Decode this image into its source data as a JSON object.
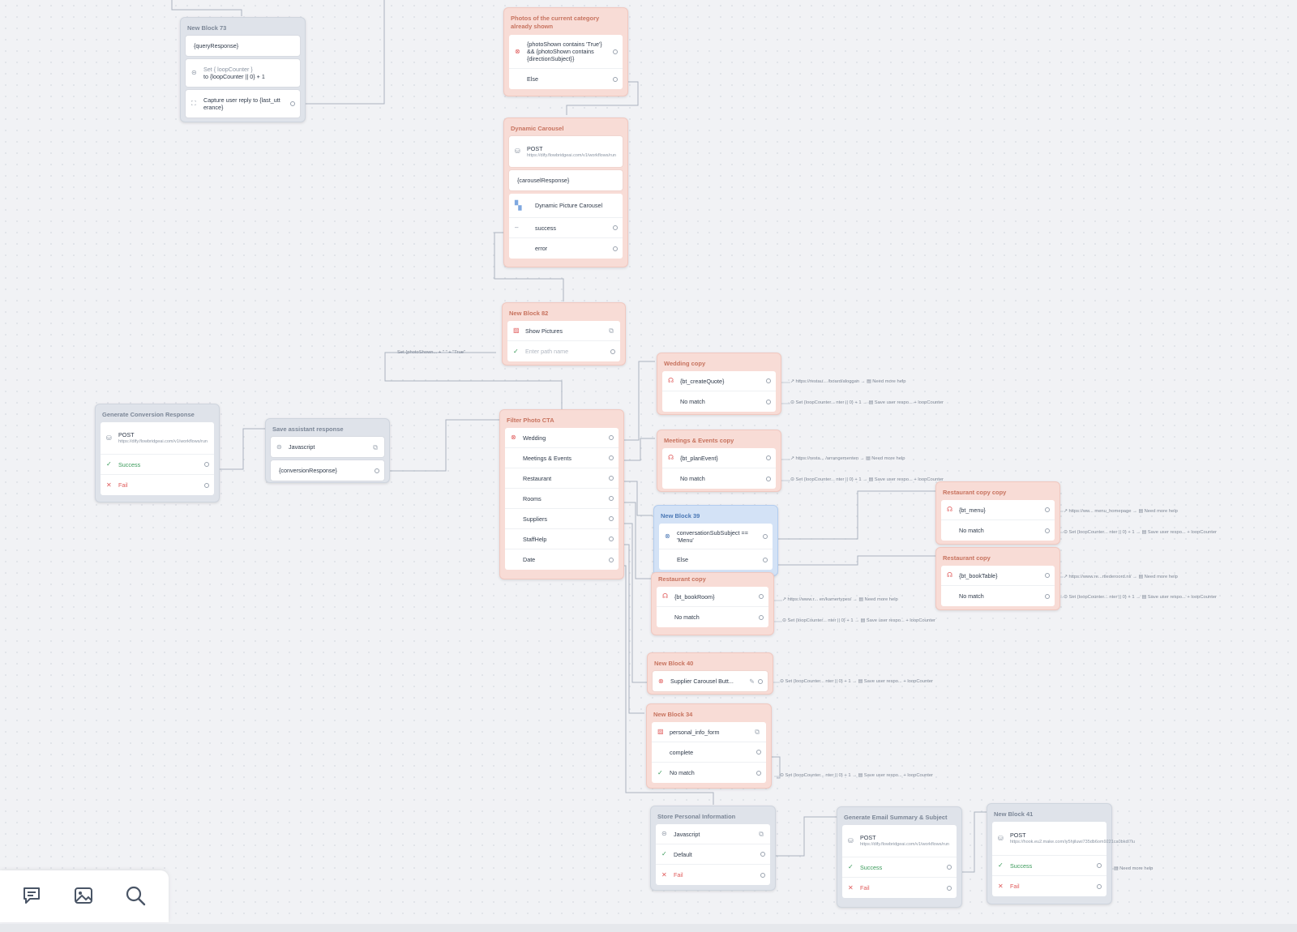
{
  "blocks": {
    "b73": {
      "title": "New Block 73",
      "r1": "{queryResponse}",
      "r2a": "Set { loopCounter }",
      "r2b": "to {loopCounter || 0} + 1",
      "r3a": "Capture user reply to {last_utt",
      "r3b": "erance}"
    },
    "photos": {
      "title": "Photos of the current category already shown",
      "cond": "{photoShown contains 'True'} && {photoShown contains {directionSubject}}",
      "else": "Else"
    },
    "dyn": {
      "title": "Dynamic Carousel",
      "post": "POST",
      "url": "https://dify.flowbridgeai.com/v1/workflows/run",
      "resp": "{carouselResponse}",
      "carousel": "Dynamic Picture Carousel",
      "success": "success",
      "error": "error"
    },
    "b82": {
      "title": "New Block 82",
      "show": "Show Pictures",
      "pathPlaceholder": "Enter path name"
    },
    "gen": {
      "title": "Generate Conversion Response",
      "post": "POST",
      "url": "https://dify.flowbridgeai.com/v1/workflows/run",
      "success": "Success",
      "fail": "Fail"
    },
    "save": {
      "title": "Save assistant response",
      "js": "Javascript",
      "resp": "{conversionResponse}"
    },
    "filter": {
      "title": "Filter Photo CTA",
      "items": [
        "Wedding",
        "Meetings & Events",
        "Restaurant",
        "Rooms",
        "Suppliers",
        "StaffHelp",
        "Date"
      ]
    },
    "wed": {
      "title": "Wedding copy",
      "intent": "{bt_createQuote}",
      "nomatch": "No match"
    },
    "meet": {
      "title": "Meetings & Events copy",
      "intent": "{bt_planEvent}",
      "nomatch": "No match"
    },
    "b39": {
      "title": "New Block 39",
      "cond": "conversationSubSubject == 'Menu'",
      "else": "Else"
    },
    "rest1": {
      "title": "Restaurant copy",
      "intent": "{bt_bookRoom}",
      "nomatch": "No match"
    },
    "restc": {
      "title": "Restaurant copy copy",
      "intent": "{bt_menu}",
      "nomatch": "No match"
    },
    "rest2": {
      "title": "Restaurant copy",
      "intent": "{bt_bookTable}",
      "nomatch": "No match"
    },
    "b40": {
      "title": "New Block 40",
      "item": "Supplier Carousel Butt..."
    },
    "b34": {
      "title": "New Block 34",
      "form": "personal_info_form",
      "complete": "complete",
      "nomatch": "No match"
    },
    "store": {
      "title": "Store Personal Information",
      "js": "Javascript",
      "default": "Default",
      "fail": "Fail"
    },
    "email": {
      "title": "Generate Email Summary & Subject",
      "post": "POST",
      "url": "https://dify.flowbridgeai.com/v1/workflows/run",
      "success": "Success",
      "fail": "Fail"
    },
    "b41": {
      "title": "New Block 41",
      "post": "POST",
      "url": "https://hook.eu2.make.com/iy5hjiluwi735db6om9221ca0bkdl7lu",
      "success": "Success",
      "fail": "Fail"
    }
  },
  "labels": {
    "setPhoto": "Set {photoShown... + \" \" + \"True\"",
    "wedUrl": "https://restau... /board/aloggan",
    "needHelp": "Need more help",
    "setLoop": "Set {loopCounter... nter || 0} + 1",
    "saveReply": "Save user respo... + loopCounter",
    "meetUrl": "https://resta... /arrangementen",
    "menuUrl": "https://ww... menu_homepage",
    "tableUrl": "https://www.re...rtlederoord.nl/",
    "roomUrl": "https://www.r... en/kamertypes/"
  },
  "toolbar": {
    "icons": [
      "comment-icon",
      "image-icon",
      "search-icon"
    ]
  },
  "colors": {
    "pinkBlock": "#f8dcd6",
    "grayBlock": "#dfe3ea",
    "blueBlock": "#d3e2f6",
    "accentRed": "#e05a5a",
    "success": "#3a9a5a"
  }
}
